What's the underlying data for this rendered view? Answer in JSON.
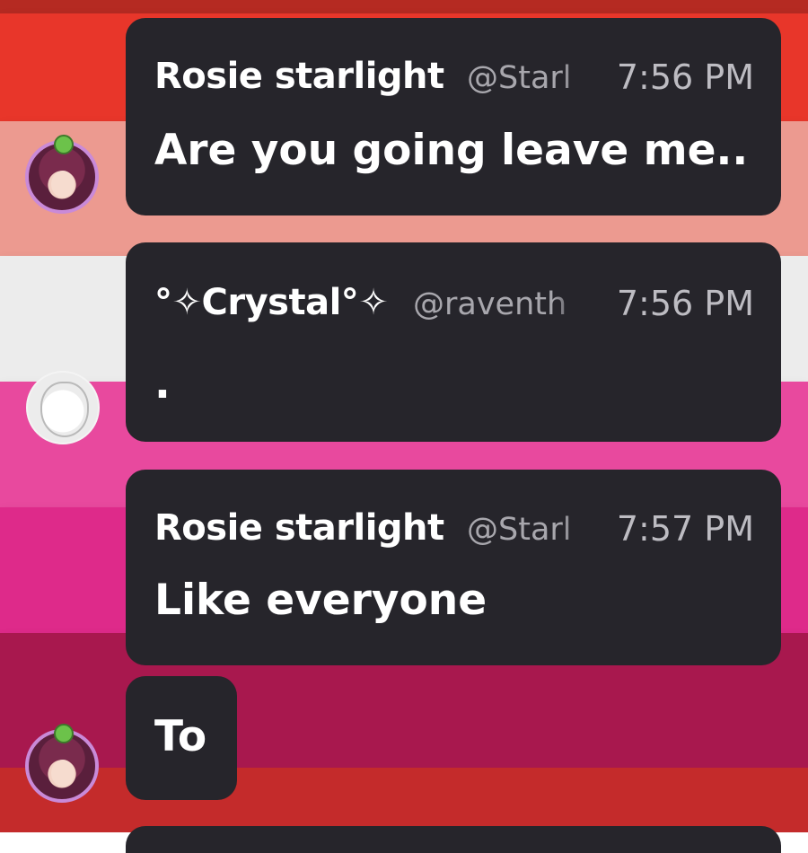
{
  "theme": {
    "bubble_color": "#26252b",
    "author_color": "#ffffff",
    "handle_color": "#a8a7ad",
    "time_color": "#bdbcc2",
    "background_stripes": [
      "#e8362a",
      "#ec9a90",
      "#ececec",
      "#e8499e",
      "#de2a8a",
      "#a8184e",
      "#c42b2b"
    ]
  },
  "messages": [
    {
      "author": "Rosie starlight",
      "handle": "@Starl",
      "time": "7:56 PM",
      "text": "Are you going leave me..",
      "avatar": "rosie-avatar"
    },
    {
      "author": "°✧Crystal°✧",
      "handle": "@raventh",
      "time": "7:56 PM",
      "text": ".",
      "avatar": "crystal-avatar"
    },
    {
      "author": "Rosie starlight",
      "handle": "@Starl",
      "time": "7:57 PM",
      "text": "Like everyone",
      "avatar": "rosie-avatar"
    }
  ],
  "continuation": {
    "text": "To",
    "avatar": "rosie-avatar"
  }
}
